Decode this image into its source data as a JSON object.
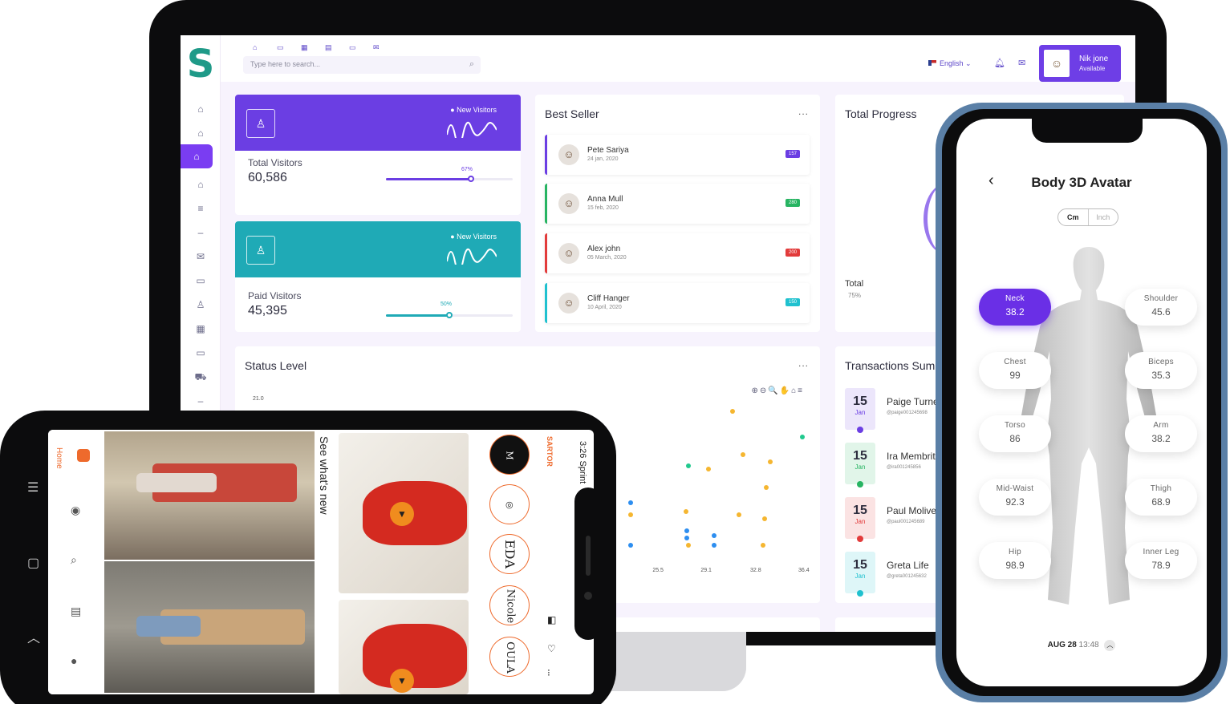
{
  "dashboard": {
    "search_placeholder": "Type here to search...",
    "language": "English",
    "user": {
      "name": "Nik jone",
      "status": "Available"
    },
    "visitors": [
      {
        "tag": "New Visitors",
        "label": "Total Visitors",
        "value": "60,586",
        "percent_text": "67%",
        "percent": 67,
        "color": "#6b3ee3"
      },
      {
        "tag": "New Visitors",
        "label": "Paid Visitors",
        "value": "45,395",
        "percent_text": "50%",
        "percent": 50,
        "color": "#1faab6"
      }
    ],
    "best_seller": {
      "title": "Best Seller",
      "more": "...",
      "items": [
        {
          "name": "Pete Sariya",
          "date": "24 jan, 2020",
          "badge": "157",
          "color": "#6b3ee3"
        },
        {
          "name": "Anna Mull",
          "date": "15 feb, 2020",
          "badge": "280",
          "color": "#27b462"
        },
        {
          "name": "Alex john",
          "date": "05 March, 2020",
          "badge": "200",
          "color": "#e23b3b"
        },
        {
          "name": "Cliff Hanger",
          "date": "10 April, 2020",
          "badge": "150",
          "color": "#1fc1cf"
        }
      ]
    },
    "total_progress": {
      "title": "Total Progress",
      "total_label": "Total",
      "total_value": "75%"
    },
    "status_level": {
      "title": "Status Level",
      "more": "...",
      "tools": "⊕⊖🔍✋⌂≡"
    },
    "transactions": {
      "title": "Transactions Sum",
      "items": [
        {
          "day": "15",
          "month": "Jan",
          "name": "Paige Turner",
          "email": "@paige001245698",
          "color": "#6b3ee3",
          "bg": "#ece6fb"
        },
        {
          "day": "15",
          "month": "Jan",
          "name": "Ira Membrit",
          "email": "@ira001245856",
          "color": "#27b462",
          "bg": "#e1f5e9"
        },
        {
          "day": "15",
          "month": "Jan",
          "name": "Paul Molive",
          "email": "@paul001245689",
          "color": "#e23b3b",
          "bg": "#fbe3e3"
        },
        {
          "day": "15",
          "month": "Jan",
          "name": "Greta Life",
          "email": "@greta001245632",
          "color": "#1fc1cf",
          "bg": "#def6f8"
        }
      ]
    }
  },
  "chart_data": {
    "type": "scatter",
    "title": "Status Level",
    "y_tick_top": "21.0",
    "x_ticks": [
      "25.5",
      "29.1",
      "32.8",
      "36.4"
    ],
    "xlim": [
      22.0,
      36.4
    ],
    "series": [
      {
        "color": "#2d8ef0",
        "points": [
          [
            23.4,
            13.0
          ],
          [
            23.4,
            9.5
          ],
          [
            27.6,
            10.1
          ],
          [
            27.6,
            10.7
          ],
          [
            29.6,
            10.3
          ],
          [
            29.6,
            9.5
          ]
        ]
      },
      {
        "color": "#f5b630",
        "points": [
          [
            31.0,
            20.6
          ],
          [
            29.2,
            15.8
          ],
          [
            31.8,
            17.0
          ],
          [
            33.5,
            14.3
          ],
          [
            31.5,
            12.0
          ],
          [
            23.4,
            12.0
          ],
          [
            27.5,
            12.3
          ],
          [
            33.4,
            11.7
          ],
          [
            27.7,
            9.5
          ],
          [
            33.3,
            9.5
          ],
          [
            33.8,
            16.4
          ]
        ]
      },
      {
        "color": "#21c98e",
        "points": [
          [
            36.2,
            18.5
          ],
          [
            27.7,
            16.1
          ]
        ]
      }
    ]
  },
  "social_app": {
    "home_label": "Home",
    "feed_heading": "See what's new",
    "brand": "SARTOR",
    "clock": "3:26 Sprint",
    "brands": [
      "M",
      "◎",
      "EDA",
      "Nicole",
      "OULA"
    ]
  },
  "avatar_app": {
    "title": "Body 3D Avatar",
    "units": [
      "Cm",
      "Inch"
    ],
    "measurements": [
      {
        "name": "Neck",
        "value": "38.2",
        "side": "left",
        "active": true
      },
      {
        "name": "Shoulder",
        "value": "45.6",
        "side": "right",
        "active": false
      },
      {
        "name": "Chest",
        "value": "99",
        "side": "left",
        "active": false
      },
      {
        "name": "Biceps",
        "value": "35.3",
        "side": "right",
        "active": false
      },
      {
        "name": "Torso",
        "value": "86",
        "side": "left",
        "active": false
      },
      {
        "name": "Arm",
        "value": "38.2",
        "side": "right",
        "active": false
      },
      {
        "name": "Mid-Waist",
        "value": "92.3",
        "side": "left",
        "active": false
      },
      {
        "name": "Thigh",
        "value": "68.9",
        "side": "right",
        "active": false
      },
      {
        "name": "Hip",
        "value": "98.9",
        "side": "left",
        "active": false
      },
      {
        "name": "Inner Leg",
        "value": "78.9",
        "side": "right",
        "active": false
      }
    ],
    "date": "AUG 28",
    "time": "13:48"
  }
}
